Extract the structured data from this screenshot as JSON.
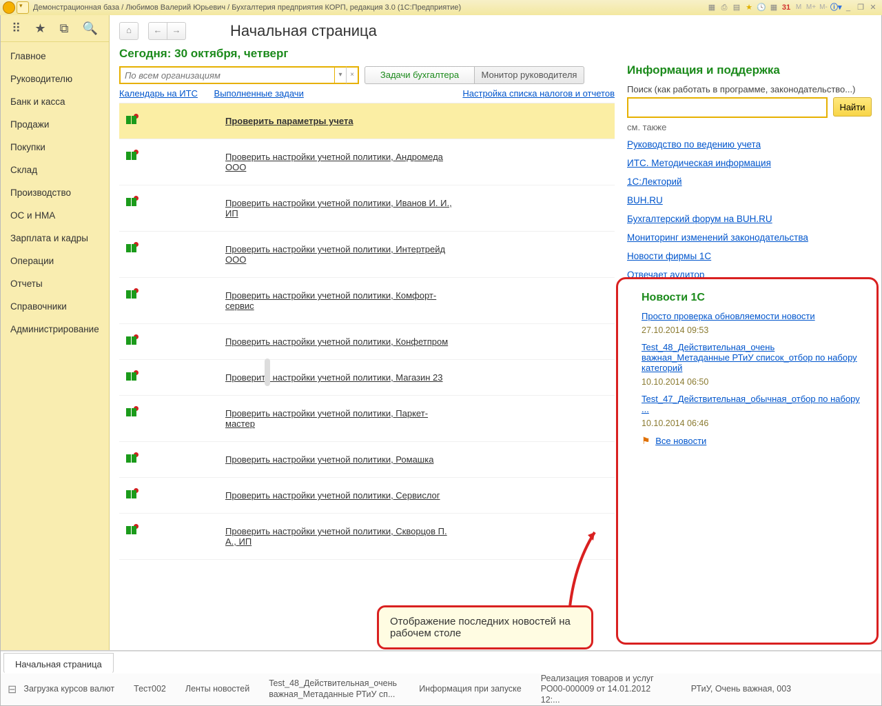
{
  "titlebar": {
    "text": "Демонстрационная база / Любимов Валерий Юрьевич / Бухгалтерия предприятия КОРП, редакция 3.0  (1С:Предприятие)",
    "m_buttons": [
      "M",
      "M+",
      "M-"
    ],
    "window_buttons": [
      "_",
      "❐",
      "✕"
    ]
  },
  "sidebar": {
    "items": [
      "Главное",
      "Руководителю",
      "Банк и касса",
      "Продажи",
      "Покупки",
      "Склад",
      "Производство",
      "ОС и НМА",
      "Зарплата и кадры",
      "Операции",
      "Отчеты",
      "Справочники",
      "Администрирование"
    ]
  },
  "nav": {
    "home": "⌂",
    "back": "←",
    "fwd": "→",
    "page_title": "Начальная страница"
  },
  "today": "Сегодня: 30 октября, четверг",
  "filter": {
    "placeholder": "По всем организациям",
    "tab_active": "Задачи бухгалтера",
    "tab_inactive": "Монитор руководителя"
  },
  "links": {
    "l1": "Календарь на ИТС",
    "l2": "Выполненные задачи",
    "r1": "Настройка списка налогов и отчетов"
  },
  "tasks": [
    "Проверить параметры учета",
    "Проверить настройки учетной политики, Андромеда ООО",
    "Проверить настройки учетной политики, Иванов И. И., ИП",
    "Проверить настройки учетной политики, Интертрейд ООО",
    "Проверить настройки учетной политики, Комфорт-сервис",
    "Проверить настройки учетной политики, Конфетпром",
    "Проверить настройки учетной политики, Магазин 23",
    "Проверить настройки учетной политики, Паркет-мастер",
    "Проверить настройки учетной политики, Ромашка",
    "Проверить настройки учетной политики, Сервислог",
    "Проверить настройки учетной политики, Скворцов П. А., ИП"
  ],
  "info": {
    "title": "Информация и поддержка",
    "search_label": "Поиск (как работать в программе, законодательство...)",
    "search_btn": "Найти",
    "see_also": "см. также",
    "links": [
      "Руководство по ведению учета",
      "ИТС. Методическая информация",
      "1С:Лекторий",
      "BUH.RU",
      "Бухгалтерский форум на BUH.RU",
      "Мониторинг изменений законодательства",
      "Новости фирмы 1С",
      "Отвечает аудитор"
    ]
  },
  "news": {
    "title": "Новости 1С",
    "items": [
      {
        "link": "Просто проверка обновляемости новости",
        "date": "27.10.2014 09:53"
      },
      {
        "link": "Test_48_Действительная_очень важная_Метаданные РТиУ список_отбор по набору категорий",
        "date": "10.10.2014 06:50"
      },
      {
        "link": "Test_47_Действительная_обычная_отбор по набору ...",
        "date": "10.10.2014 06:46"
      }
    ],
    "all": "Все новости"
  },
  "callout": "Отображение последних новостей на рабочем столе",
  "bottom_tabs": {
    "active": "Начальная страница"
  },
  "statusbar": [
    "Загрузка курсов валют",
    "Тест002",
    "Ленты новостей",
    "Test_48_Действительная_очень важная_Метаданные РТиУ сп...",
    "Информация при запуске",
    "Реализация товаров и услуг РО00-000009 от 14.01.2012 12:...",
    "РТиУ,  Очень важная, 003"
  ]
}
